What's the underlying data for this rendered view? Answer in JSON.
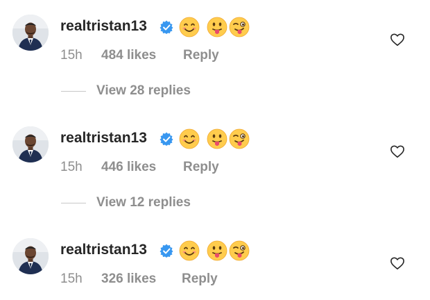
{
  "comments": [
    {
      "username": "realtristan13",
      "verified_icon": "verified-badge-icon",
      "emojis": [
        "smiling-face-icon",
        "tongue-out-icon",
        "winking-tongue-icon"
      ],
      "time": "15h",
      "likes": "484 likes",
      "reply_label": "Reply",
      "view_replies": "View 28 replies"
    },
    {
      "username": "realtristan13",
      "verified_icon": "verified-badge-icon",
      "emojis": [
        "smiling-face-icon",
        "tongue-out-icon",
        "winking-tongue-icon"
      ],
      "time": "15h",
      "likes": "446 likes",
      "reply_label": "Reply",
      "view_replies": "View 12 replies"
    },
    {
      "username": "realtristan13",
      "verified_icon": "verified-badge-icon",
      "emojis": [
        "smiling-face-icon",
        "tongue-out-icon",
        "winking-tongue-icon"
      ],
      "time": "15h",
      "likes": "326 likes",
      "reply_label": "Reply"
    }
  ],
  "colors": {
    "text_primary": "#262626",
    "text_secondary": "#8e8e8e",
    "verified_blue": "#3897f0",
    "emoji_yellow": "#ffcc4d"
  }
}
